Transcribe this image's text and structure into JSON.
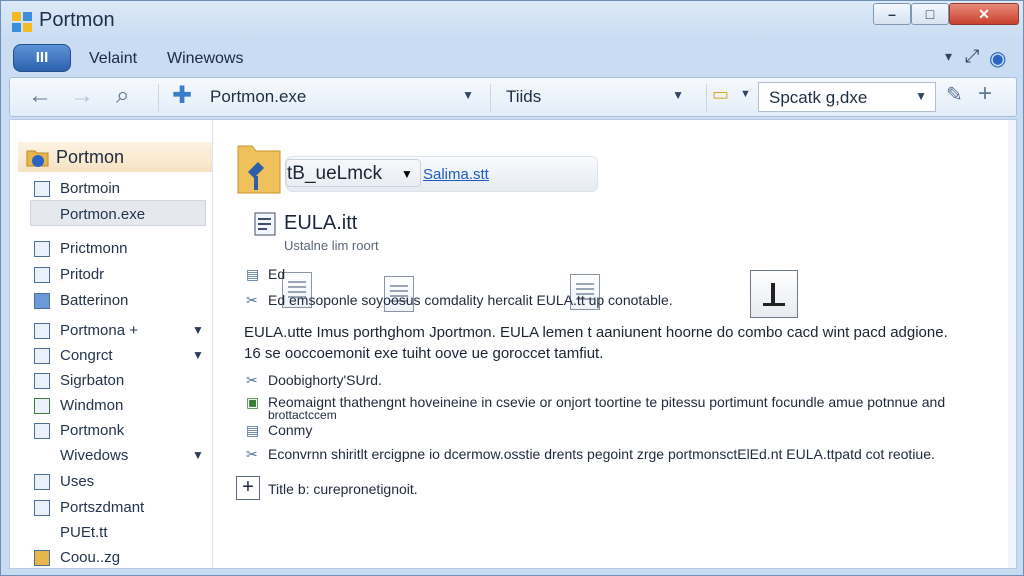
{
  "window": {
    "title": "Portmon",
    "controls": {
      "minimize": "–",
      "maximize": "□",
      "close": "✕"
    }
  },
  "menubar": {
    "orb_label": "III",
    "items": [
      "Velaint",
      "Winewows"
    ]
  },
  "toolbar": {
    "location_value": "Portmon.exe",
    "middle_combo_value": "Tiids",
    "search_combo_value": "Spcatk g,dxe"
  },
  "sidebar": {
    "header": "Portmon",
    "items": [
      {
        "label": "Bortmoin",
        "has_dropdown": false
      },
      {
        "label": "Portmon.exe",
        "has_dropdown": false,
        "selected": true
      },
      {
        "label": "Prictmonn",
        "has_dropdown": false
      },
      {
        "label": "Pritodr",
        "has_dropdown": false
      },
      {
        "label": "Batterinon",
        "has_dropdown": false
      },
      {
        "label": "Portmona +",
        "has_dropdown": true
      },
      {
        "label": "Congrct",
        "has_dropdown": true
      },
      {
        "label": "Sigrbaton",
        "has_dropdown": false
      },
      {
        "label": "Windmon",
        "has_dropdown": false
      },
      {
        "label": "Portmonk",
        "has_dropdown": false
      },
      {
        "label": "Wivedows",
        "has_dropdown": true
      },
      {
        "label": "Uses",
        "has_dropdown": false
      },
      {
        "label": "Portszdmant",
        "has_dropdown": false
      },
      {
        "label": "PUEt.tt",
        "has_dropdown": false
      },
      {
        "label": "Coou..zg",
        "has_dropdown": false
      }
    ]
  },
  "content": {
    "dropdown_label": "tB_ueLmck",
    "link_text": "Salima.stt",
    "file_title": "EULA.itt",
    "file_subtitle": "Ustalne lim roort",
    "rows": [
      {
        "icon": "doc",
        "text": "Ed"
      },
      {
        "icon": "tool",
        "text": "Ed emsoponle soyoosus comdality hercalit EULA.tt up conotable."
      },
      {
        "icon": "none",
        "text": "EULA.utte Imus porthghom Jportmon. EULA lemen t aaniunent hoorne do combo cacd wint pacd adgione."
      },
      {
        "icon": "none",
        "text": "16 se ooccoemonit exe tuiht oove ue goroccet tamfiut."
      },
      {
        "icon": "tool",
        "text": "Doobighorty'SUrd."
      },
      {
        "icon": "img",
        "text": "Reomaignt thathengnt hoveineine in csevie or onjort toortine te pitessu portimunt focundle amue potnnue and"
      },
      {
        "icon": "none",
        "text": "brottactccem"
      },
      {
        "icon": "doc",
        "text": "Conmy"
      },
      {
        "icon": "tool",
        "text": "Econvrnn shiritlt ercigpne io dcermow.osstie drents pegoint zrge portmonsctElEd.nt EULA.ttpatd cot reotiue."
      }
    ],
    "footer_action": "Title b: curepronetignoit."
  },
  "colors": {
    "accent": "#2b62ad",
    "link": "#1f5cc2",
    "sidebar_header": "#f6e2c4"
  }
}
